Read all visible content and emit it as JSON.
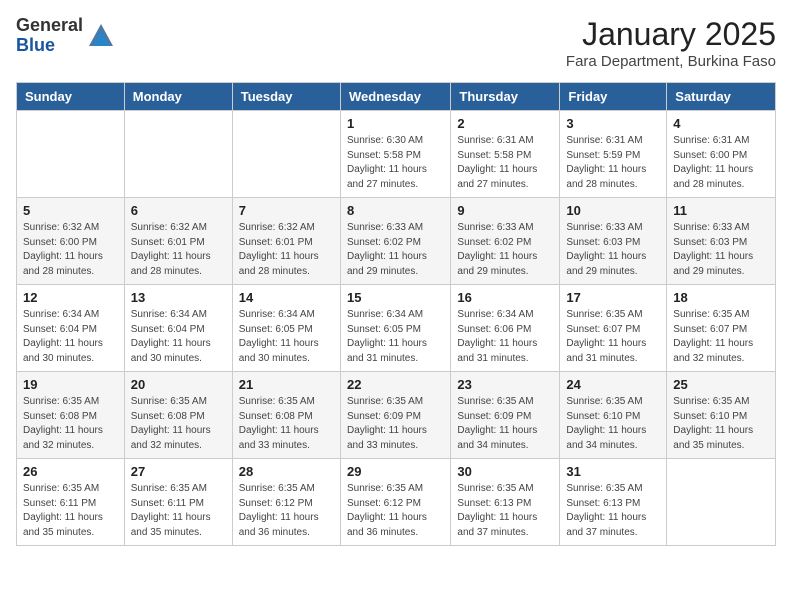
{
  "logo": {
    "general": "General",
    "blue": "Blue"
  },
  "title": "January 2025",
  "location": "Fara Department, Burkina Faso",
  "days_header": [
    "Sunday",
    "Monday",
    "Tuesday",
    "Wednesday",
    "Thursday",
    "Friday",
    "Saturday"
  ],
  "weeks": [
    {
      "days": [
        {
          "num": "",
          "sunrise": "",
          "sunset": "",
          "daylight": ""
        },
        {
          "num": "",
          "sunrise": "",
          "sunset": "",
          "daylight": ""
        },
        {
          "num": "",
          "sunrise": "",
          "sunset": "",
          "daylight": ""
        },
        {
          "num": "1",
          "sunrise": "Sunrise: 6:30 AM",
          "sunset": "Sunset: 5:58 PM",
          "daylight": "Daylight: 11 hours and 27 minutes."
        },
        {
          "num": "2",
          "sunrise": "Sunrise: 6:31 AM",
          "sunset": "Sunset: 5:58 PM",
          "daylight": "Daylight: 11 hours and 27 minutes."
        },
        {
          "num": "3",
          "sunrise": "Sunrise: 6:31 AM",
          "sunset": "Sunset: 5:59 PM",
          "daylight": "Daylight: 11 hours and 28 minutes."
        },
        {
          "num": "4",
          "sunrise": "Sunrise: 6:31 AM",
          "sunset": "Sunset: 6:00 PM",
          "daylight": "Daylight: 11 hours and 28 minutes."
        }
      ]
    },
    {
      "days": [
        {
          "num": "5",
          "sunrise": "Sunrise: 6:32 AM",
          "sunset": "Sunset: 6:00 PM",
          "daylight": "Daylight: 11 hours and 28 minutes."
        },
        {
          "num": "6",
          "sunrise": "Sunrise: 6:32 AM",
          "sunset": "Sunset: 6:01 PM",
          "daylight": "Daylight: 11 hours and 28 minutes."
        },
        {
          "num": "7",
          "sunrise": "Sunrise: 6:32 AM",
          "sunset": "Sunset: 6:01 PM",
          "daylight": "Daylight: 11 hours and 28 minutes."
        },
        {
          "num": "8",
          "sunrise": "Sunrise: 6:33 AM",
          "sunset": "Sunset: 6:02 PM",
          "daylight": "Daylight: 11 hours and 29 minutes."
        },
        {
          "num": "9",
          "sunrise": "Sunrise: 6:33 AM",
          "sunset": "Sunset: 6:02 PM",
          "daylight": "Daylight: 11 hours and 29 minutes."
        },
        {
          "num": "10",
          "sunrise": "Sunrise: 6:33 AM",
          "sunset": "Sunset: 6:03 PM",
          "daylight": "Daylight: 11 hours and 29 minutes."
        },
        {
          "num": "11",
          "sunrise": "Sunrise: 6:33 AM",
          "sunset": "Sunset: 6:03 PM",
          "daylight": "Daylight: 11 hours and 29 minutes."
        }
      ]
    },
    {
      "days": [
        {
          "num": "12",
          "sunrise": "Sunrise: 6:34 AM",
          "sunset": "Sunset: 6:04 PM",
          "daylight": "Daylight: 11 hours and 30 minutes."
        },
        {
          "num": "13",
          "sunrise": "Sunrise: 6:34 AM",
          "sunset": "Sunset: 6:04 PM",
          "daylight": "Daylight: 11 hours and 30 minutes."
        },
        {
          "num": "14",
          "sunrise": "Sunrise: 6:34 AM",
          "sunset": "Sunset: 6:05 PM",
          "daylight": "Daylight: 11 hours and 30 minutes."
        },
        {
          "num": "15",
          "sunrise": "Sunrise: 6:34 AM",
          "sunset": "Sunset: 6:05 PM",
          "daylight": "Daylight: 11 hours and 31 minutes."
        },
        {
          "num": "16",
          "sunrise": "Sunrise: 6:34 AM",
          "sunset": "Sunset: 6:06 PM",
          "daylight": "Daylight: 11 hours and 31 minutes."
        },
        {
          "num": "17",
          "sunrise": "Sunrise: 6:35 AM",
          "sunset": "Sunset: 6:07 PM",
          "daylight": "Daylight: 11 hours and 31 minutes."
        },
        {
          "num": "18",
          "sunrise": "Sunrise: 6:35 AM",
          "sunset": "Sunset: 6:07 PM",
          "daylight": "Daylight: 11 hours and 32 minutes."
        }
      ]
    },
    {
      "days": [
        {
          "num": "19",
          "sunrise": "Sunrise: 6:35 AM",
          "sunset": "Sunset: 6:08 PM",
          "daylight": "Daylight: 11 hours and 32 minutes."
        },
        {
          "num": "20",
          "sunrise": "Sunrise: 6:35 AM",
          "sunset": "Sunset: 6:08 PM",
          "daylight": "Daylight: 11 hours and 32 minutes."
        },
        {
          "num": "21",
          "sunrise": "Sunrise: 6:35 AM",
          "sunset": "Sunset: 6:08 PM",
          "daylight": "Daylight: 11 hours and 33 minutes."
        },
        {
          "num": "22",
          "sunrise": "Sunrise: 6:35 AM",
          "sunset": "Sunset: 6:09 PM",
          "daylight": "Daylight: 11 hours and 33 minutes."
        },
        {
          "num": "23",
          "sunrise": "Sunrise: 6:35 AM",
          "sunset": "Sunset: 6:09 PM",
          "daylight": "Daylight: 11 hours and 34 minutes."
        },
        {
          "num": "24",
          "sunrise": "Sunrise: 6:35 AM",
          "sunset": "Sunset: 6:10 PM",
          "daylight": "Daylight: 11 hours and 34 minutes."
        },
        {
          "num": "25",
          "sunrise": "Sunrise: 6:35 AM",
          "sunset": "Sunset: 6:10 PM",
          "daylight": "Daylight: 11 hours and 35 minutes."
        }
      ]
    },
    {
      "days": [
        {
          "num": "26",
          "sunrise": "Sunrise: 6:35 AM",
          "sunset": "Sunset: 6:11 PM",
          "daylight": "Daylight: 11 hours and 35 minutes."
        },
        {
          "num": "27",
          "sunrise": "Sunrise: 6:35 AM",
          "sunset": "Sunset: 6:11 PM",
          "daylight": "Daylight: 11 hours and 35 minutes."
        },
        {
          "num": "28",
          "sunrise": "Sunrise: 6:35 AM",
          "sunset": "Sunset: 6:12 PM",
          "daylight": "Daylight: 11 hours and 36 minutes."
        },
        {
          "num": "29",
          "sunrise": "Sunrise: 6:35 AM",
          "sunset": "Sunset: 6:12 PM",
          "daylight": "Daylight: 11 hours and 36 minutes."
        },
        {
          "num": "30",
          "sunrise": "Sunrise: 6:35 AM",
          "sunset": "Sunset: 6:13 PM",
          "daylight": "Daylight: 11 hours and 37 minutes."
        },
        {
          "num": "31",
          "sunrise": "Sunrise: 6:35 AM",
          "sunset": "Sunset: 6:13 PM",
          "daylight": "Daylight: 11 hours and 37 minutes."
        },
        {
          "num": "",
          "sunrise": "",
          "sunset": "",
          "daylight": ""
        }
      ]
    }
  ]
}
